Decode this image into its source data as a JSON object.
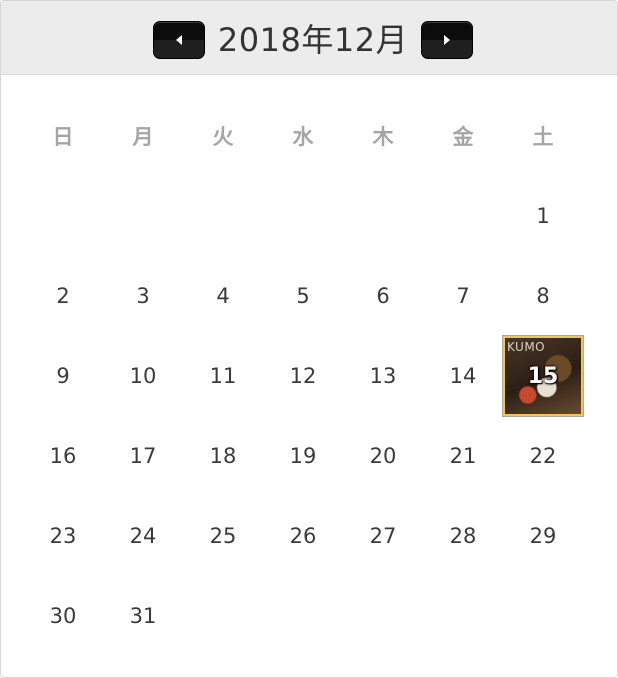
{
  "header": {
    "title": "2018年12月",
    "prev_icon": "triangle-left-icon",
    "next_icon": "triangle-right-icon"
  },
  "weekdays": [
    "日",
    "月",
    "火",
    "水",
    "木",
    "金",
    "土"
  ],
  "weeks": [
    [
      "",
      "",
      "",
      "",
      "",
      "",
      "1"
    ],
    [
      "2",
      "3",
      "4",
      "5",
      "6",
      "7",
      "8"
    ],
    [
      "9",
      "10",
      "11",
      "12",
      "13",
      "14",
      "15"
    ],
    [
      "16",
      "17",
      "18",
      "19",
      "20",
      "21",
      "22"
    ],
    [
      "23",
      "24",
      "25",
      "26",
      "27",
      "28",
      "29"
    ],
    [
      "30",
      "31",
      "",
      "",
      "",
      "",
      ""
    ]
  ],
  "highlight": {
    "day": "15",
    "watermark": "KUMO"
  },
  "colors": {
    "header_bg": "#ececec",
    "nav_button": "#0c0c0c",
    "weekday_text": "#a5a5a5",
    "day_text": "#3b3b3b",
    "highlight_border": "#f3c35e"
  }
}
